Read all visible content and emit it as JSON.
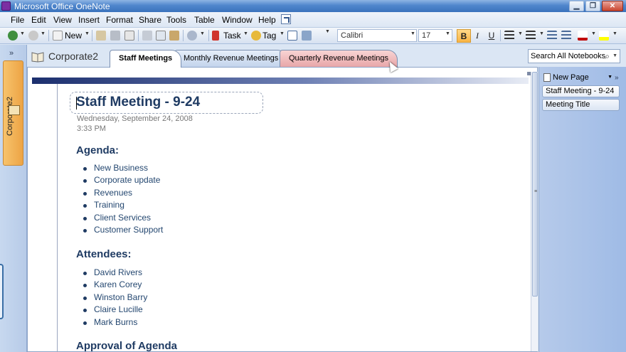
{
  "window": {
    "title": "Microsoft Office OneNote",
    "minimize_glyph": "▁",
    "maximize_glyph": "❐",
    "close_glyph": "✕"
  },
  "menu": [
    "File",
    "Edit",
    "View",
    "Insert",
    "Format",
    "Share",
    "Tools",
    "Table",
    "Window",
    "Help"
  ],
  "toolbar": {
    "new_label": "New",
    "task_label": "Task",
    "tag_label": "Tag",
    "font_name": "Calibri",
    "font_size": "17",
    "bold": "B",
    "italic": "I",
    "underline": "U",
    "bold_active": true,
    "font_color": "#c00000",
    "highlight_color": "#ffff00"
  },
  "icons": {
    "nav_expand": "»",
    "search": "⌕",
    "dropdown": "▼",
    "grip": "≡"
  },
  "notebook": {
    "name": "Corporate2",
    "sections": [
      {
        "label": "Staff Meetings",
        "color": "#ffffff",
        "active": true
      },
      {
        "label": "Monthly Revenue Meetings",
        "color": "#c3d4ec",
        "active": false
      },
      {
        "label": "Quarterly Revenue Meetings",
        "color": "#e8a6a8",
        "active": false
      }
    ]
  },
  "search": {
    "placeholder": "Search All Notebooks"
  },
  "page": {
    "title": "Staff Meeting - 9-24",
    "date": "Wednesday, September  24, 2008",
    "time": "3:33 PM",
    "sections": [
      {
        "heading": "Agenda:",
        "items": [
          "New Business",
          "Corporate update",
          "Revenues",
          "Training",
          "Client Services",
          "Customer Support"
        ]
      },
      {
        "heading": "Attendees:",
        "items": [
          "David Rivers",
          "Karen Corey",
          "Winston Barry",
          "Claire Lucille",
          "Mark Burns"
        ]
      },
      {
        "heading": "Approval of Agenda",
        "items": []
      }
    ]
  },
  "pages_pane": {
    "new_page_label": "New Page",
    "pages": [
      "Staff Meeting - 9-24",
      "Meeting Title"
    ]
  }
}
